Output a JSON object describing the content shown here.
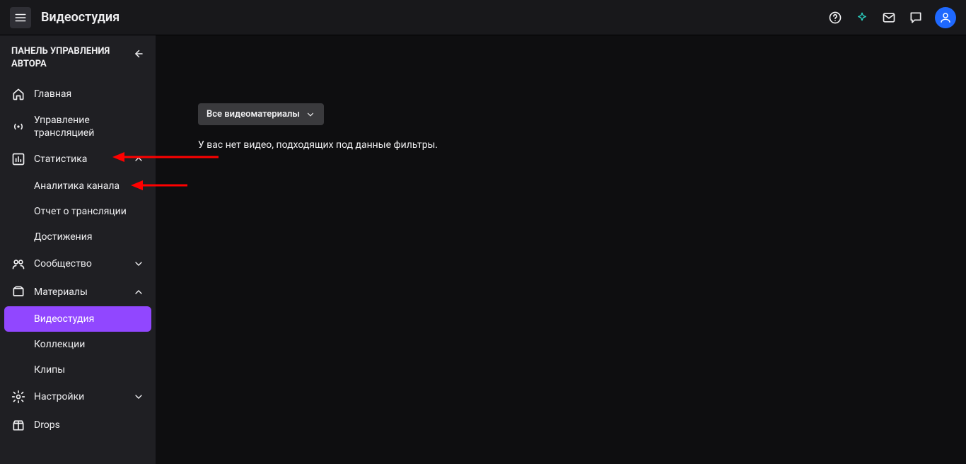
{
  "header": {
    "title": "Видеостудия"
  },
  "sidebar": {
    "panel_title": "ПАНЕЛЬ УПРАВЛЕНИЯ АВТОРА",
    "home": "Главная",
    "stream_mgmt": "Управление трансляцией",
    "stats": "Статистика",
    "stats_children": {
      "channel_analytics": "Аналитика канала",
      "stream_report": "Отчет о трансляции",
      "achievements": "Достижения"
    },
    "community": "Сообщество",
    "materials": "Материалы",
    "materials_children": {
      "video_studio": "Видеостудия",
      "collections": "Коллекции",
      "clips": "Клипы"
    },
    "settings": "Настройки",
    "drops": "Drops"
  },
  "content": {
    "filter_label": "Все видеоматериалы",
    "empty_message": "У вас нет видео, подходящих под данные фильтры."
  }
}
